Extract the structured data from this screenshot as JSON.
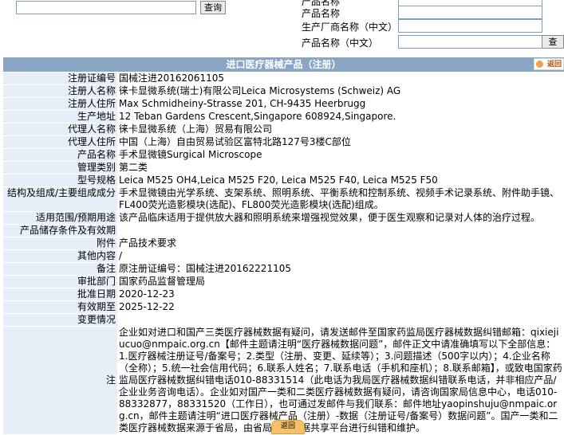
{
  "search": {
    "left_button": "查询",
    "right_button": "查询",
    "labels": [
      "产品名称",
      "生产厂商名称（中文）",
      "产品名称（中文）"
    ],
    "partial_label": "产品名称"
  },
  "title": "进口医疗器械产品（注册）",
  "back_label": "返回",
  "rows": [
    {
      "label": "注册证编号",
      "value": "国械注进20162061105"
    },
    {
      "label": "注册人名称",
      "value": "徕卡显微系统(瑞士)有限公司Leica Microsystems (Schweiz) AG"
    },
    {
      "label": "注册人住所",
      "value": "Max Schmidheiny-Strasse 201, CH-9435 Heerbrugg"
    },
    {
      "label": "生产地址",
      "value": "12 Teban Gardens Crescent,Singapore 608924,Singapore."
    },
    {
      "label": "代理人名称",
      "value": "徕卡显微系统（上海）贸易有限公司"
    },
    {
      "label": "代理人住所",
      "value": "中国（上海）自由贸易试验区富特北路127号3楼C部位"
    },
    {
      "label": "产品名称",
      "value": "手术显微镜Surgical Microscope"
    },
    {
      "label": "管理类别",
      "value": "第二类"
    },
    {
      "label": "型号规格",
      "value": "Leica M525 OH4,Leica M525 F20, Leica M525 F40, Leica M525 F50"
    },
    {
      "label": "结构及组成/主要组成成分",
      "value": "手术显微镜由光学系统、支架系统、照明系统、平衡系统和控制系统、视频手术记录系统、附件助手镜、FL400荧光造影模块(选配)、FL800荧光造影模块(选配)组成。"
    },
    {
      "label": "适用范围/预期用途",
      "value": "该产品临床适用于提供放大器和照明系统来增强视觉效果，便于医生观察和记录对人体的治疗过程。"
    },
    {
      "label": "产品储存条件及有效期",
      "value": ""
    },
    {
      "label": "附件",
      "value": "产品技术要求"
    },
    {
      "label": "其他内容",
      "value": "/"
    },
    {
      "label": "备注",
      "value": "原注册证编号：国械注进20162221105"
    },
    {
      "label": "审批部门",
      "value": "国家药品监督管理局"
    },
    {
      "label": "批准日期",
      "value": "2020-12-23"
    },
    {
      "label": "有效期至",
      "value": "2025-12-22"
    },
    {
      "label": "变更情况",
      "value": ""
    }
  ],
  "note": {
    "label": "注",
    "text": "企业如对进口和国产三类医疗器械数据有疑问，请发送邮件至国家药监局医疗器械数据纠错邮箱：qixiejiucuo@nmpaic.org.cn【邮件主题请注明“医疗器械数据问题”，邮件正文中请准确填写以下全部信息：1.医疗器械注册证号/备案号；2.类型（注册、变更、延续等）；3.问题描述（500字以内）；4.企业名称（全称）；5.统一社会信用代码；6.联系人姓名；7.联系电话（手机和座机）；8.联系邮箱】，或致电国家药监局医疗器械数据纠错电话010-88331514（此电话为我局医疗器械数据纠错联系电话，并非相应产品/企业业务咨询电话）。企业如对国产一类和二类医疗器械数据有疑问，请咨询国家局信息中心，电话010-88332877，88331520（工作日），也可通过发邮件与我们联系：邮件地址yaopinshuju@nmpaic.org.cn，邮件主题请注明“进口医疗器械产品（注册）-数据（注册证号/备案号）数据问题”。国产一类和二类医疗器械数据来源于省局，由省局通过数据共享平台进行纠错和维护。"
  },
  "bottom_back_label": "返回"
}
